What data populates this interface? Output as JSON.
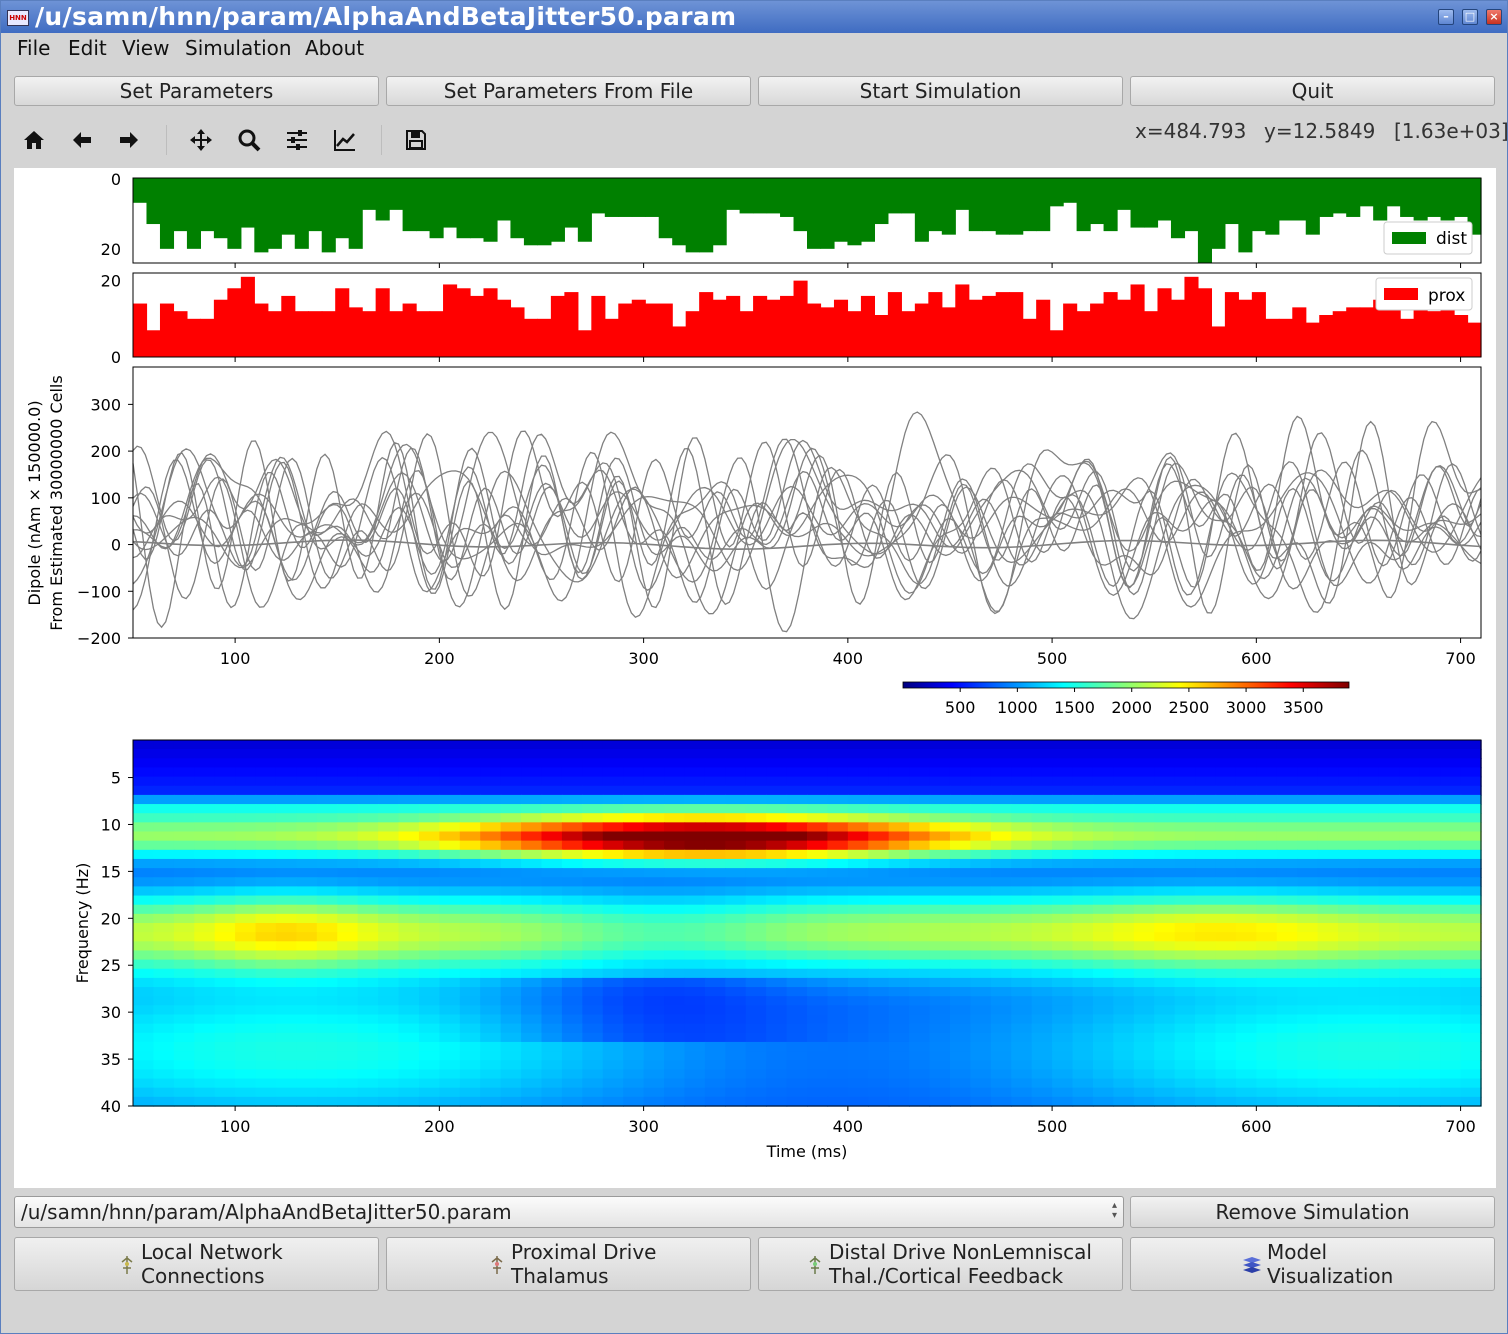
{
  "window": {
    "title": "/u/samn/hnn/param/AlphaAndBetaJitter50.param",
    "app_icon_text": "HNN",
    "minimize_glyph": "–",
    "maximize_glyph": "□",
    "close_glyph": "×"
  },
  "menu": [
    "File",
    "Edit",
    "View",
    "Simulation",
    "About"
  ],
  "buttons": {
    "set_params": "Set Parameters",
    "set_params_file": "Set Parameters From File",
    "start_sim": "Start Simulation",
    "quit": "Quit"
  },
  "toolbar": {
    "icons": [
      "home-icon",
      "back-icon",
      "forward-icon",
      "pan-icon",
      "zoom-icon",
      "configure-subplots-icon",
      "edit-axes-icon",
      "save-icon"
    ],
    "coords": {
      "x": "x=484.793",
      "y": "y=12.5849",
      "value": "[1.63e+03]"
    }
  },
  "bottom": {
    "sim_combo_value": "/u/samn/hnn/param/AlphaAndBetaJitter50.param",
    "remove_sim": "Remove Simulation",
    "local_network": [
      "Local Network",
      "Connections"
    ],
    "proximal_drive": [
      "Proximal Drive",
      "Thalamus"
    ],
    "distal_drive": [
      "Distal Drive NonLemniscal",
      "Thal./Cortical Feedback"
    ],
    "model_viz": [
      "Model",
      "Visualization"
    ]
  },
  "colors": {
    "dist": "#008000",
    "prox": "#ff0000",
    "dipole": "#808080",
    "titlebar": "#4a75c8"
  },
  "chart_data": [
    {
      "type": "bar",
      "title": "",
      "legend": "dist",
      "legend_position": "right",
      "y_ticks": [
        "0",
        "20"
      ],
      "ylim_inverted": [
        0,
        24
      ],
      "x_range": [
        50,
        710
      ],
      "values": [
        7,
        13,
        20,
        15,
        20,
        15,
        17,
        20,
        14,
        21,
        20,
        16,
        20,
        15,
        21,
        17,
        20,
        9,
        12,
        9,
        15,
        15,
        17,
        14,
        17,
        17,
        18,
        12,
        17,
        19,
        19,
        18,
        14,
        18,
        10,
        11,
        11,
        11,
        11,
        17,
        19,
        21,
        21,
        19,
        9,
        10,
        10,
        10,
        11,
        15,
        20,
        20,
        18,
        19,
        18,
        13,
        10,
        10,
        18,
        15,
        16,
        9,
        15,
        15,
        16,
        16,
        15,
        15,
        8,
        7,
        15,
        13,
        15,
        9,
        14,
        14,
        12,
        17,
        15,
        24,
        20,
        13,
        21,
        15,
        16,
        12,
        12,
        16,
        11,
        10,
        11,
        8,
        12,
        8,
        11,
        12,
        11,
        12,
        11,
        16
      ]
    },
    {
      "type": "bar",
      "title": "",
      "legend": "prox",
      "legend_position": "upper-right",
      "y_ticks": [
        "0",
        "20"
      ],
      "ylim": [
        0,
        22
      ],
      "x_range": [
        50,
        710
      ],
      "values": [
        14,
        7,
        14,
        12,
        10,
        10,
        15,
        18,
        21,
        14,
        12,
        16,
        12,
        12,
        12,
        18,
        13,
        12,
        18,
        12,
        14,
        12,
        12,
        19,
        18,
        16,
        18,
        15,
        13,
        10,
        10,
        16,
        17,
        7,
        16,
        10,
        14,
        15,
        14,
        14,
        8,
        12,
        17,
        15,
        16,
        12,
        16,
        15,
        16,
        20,
        14,
        13,
        15,
        12,
        16,
        11,
        17,
        12,
        14,
        17,
        13,
        19,
        15,
        16,
        17,
        17,
        10,
        15,
        7,
        14,
        12,
        14,
        17,
        15,
        19,
        12,
        18,
        15,
        21,
        18,
        8,
        17,
        15,
        17,
        10,
        10,
        13,
        9,
        11,
        12,
        13,
        13,
        15,
        16,
        10,
        15,
        12,
        14,
        11,
        9
      ]
    },
    {
      "type": "line",
      "title": "",
      "ylabel": [
        "Dipole (nAm × 150000.0)",
        "From Estimated 30000000 Cells"
      ],
      "xlabel": "",
      "y_ticks": [
        "300",
        "200",
        "100",
        "0",
        "−100",
        "−200"
      ],
      "x_ticks": [
        "100",
        "200",
        "300",
        "400",
        "500",
        "600",
        "700"
      ],
      "ylim": [
        -200,
        380
      ],
      "xlim": [
        50,
        710
      ],
      "series_count": 12,
      "series_color": "#808080",
      "note": "12 overlapping simulated dipole traces, roughly −200 to 375 nAm-scaled, plus one near-flat average-like trace around 0"
    },
    {
      "type": "heatmap",
      "title": "",
      "colormap": "jet",
      "colorbar_ticks": [
        "500",
        "1000",
        "1500",
        "2000",
        "2500",
        "3000",
        "3500"
      ],
      "colorbar_range": [
        0,
        3900
      ],
      "xlabel": "Time (ms)",
      "ylabel": "Frequency (Hz)",
      "x_ticks": [
        "100",
        "200",
        "300",
        "400",
        "500",
        "600",
        "700"
      ],
      "y_ticks": [
        "5",
        "10",
        "15",
        "20",
        "25",
        "30",
        "35",
        "40"
      ],
      "xlim": [
        50,
        710
      ],
      "ylim": [
        1,
        40
      ],
      "peak": {
        "time_ms": 330,
        "freq_hz": 12,
        "power": 3800
      }
    }
  ]
}
